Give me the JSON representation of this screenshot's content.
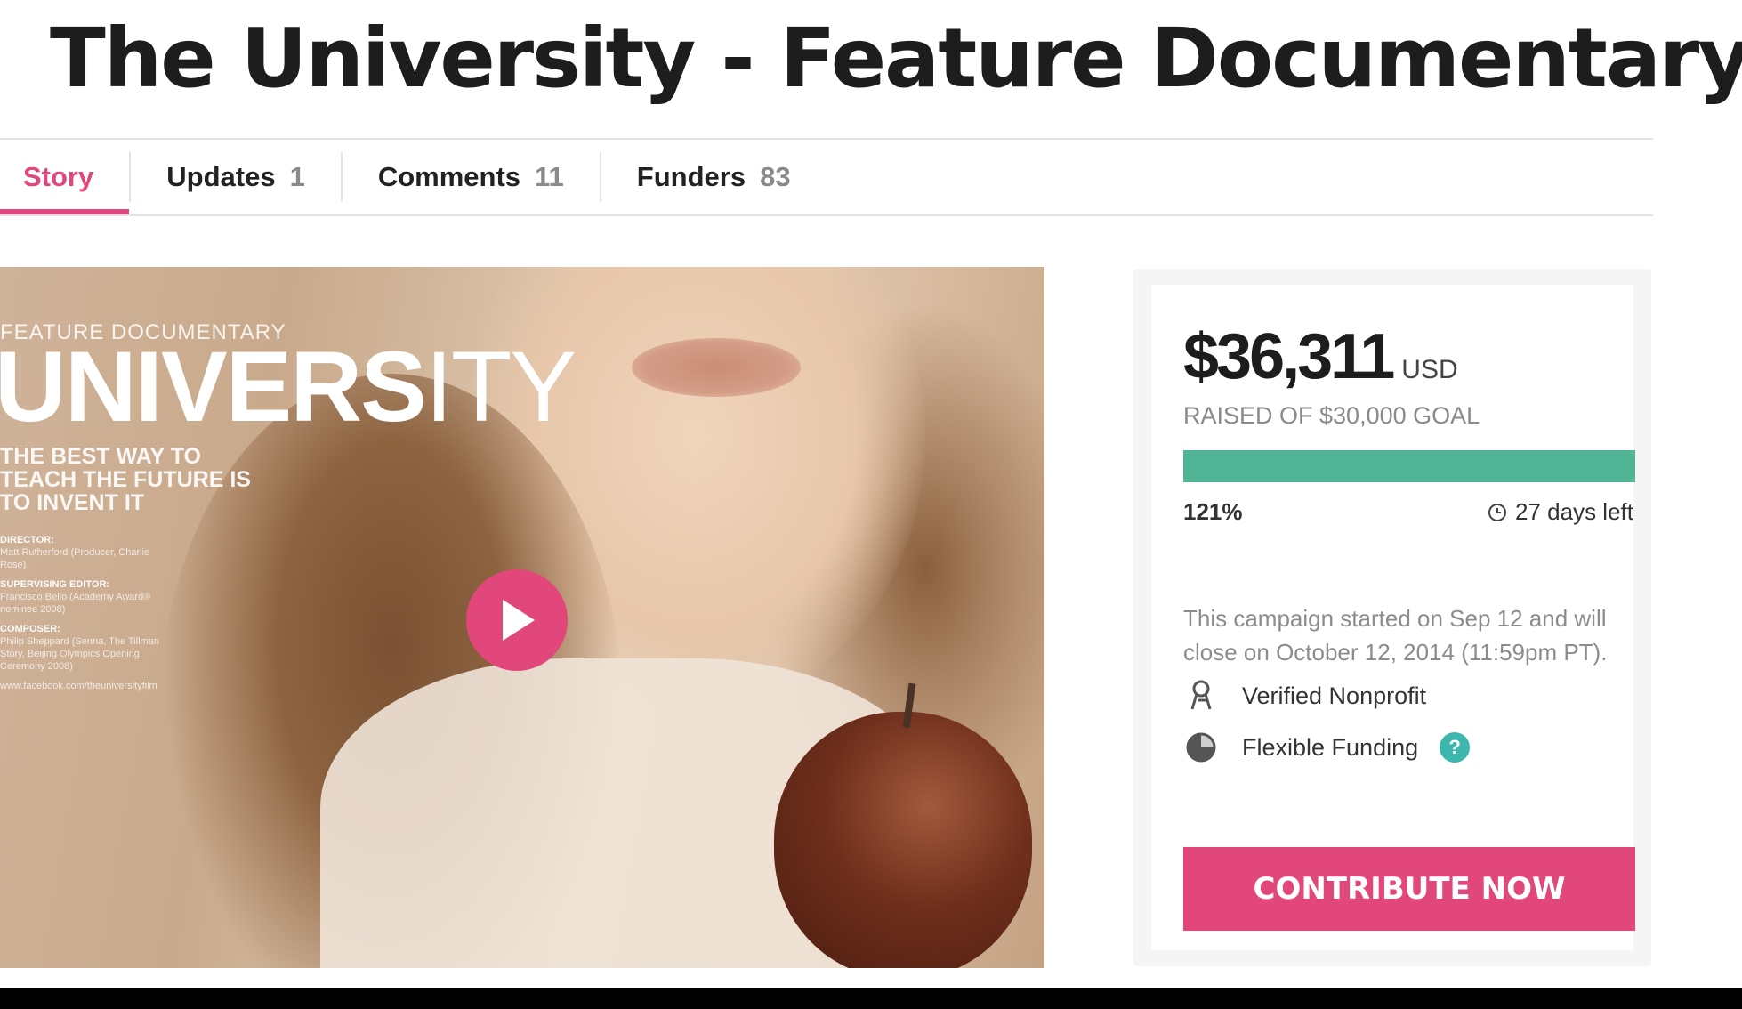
{
  "page": {
    "title": "The University - Feature Documentary"
  },
  "tabs": [
    {
      "label": "Story",
      "count": ""
    },
    {
      "label": "Updates",
      "count": "1"
    },
    {
      "label": "Comments",
      "count": "11"
    },
    {
      "label": "Funders",
      "count": "83"
    }
  ],
  "video": {
    "poster_kicker": "FEATURE DOCUMENTARY",
    "poster_logo_bold": "UNIVERS",
    "poster_logo_thin": "ITY",
    "poster_tagline": "THE BEST WAY TO TEACH THE FUTURE IS TO INVENT IT",
    "credits": [
      {
        "heading": "DIRECTOR:",
        "text": "Matt Rutherford (Producer, Charlie Rose)"
      },
      {
        "heading": "SUPERVISING EDITOR:",
        "text": "Francisco Bello (Academy Award® nominee 2008)"
      },
      {
        "heading": "COMPOSER:",
        "text": "Philip Sheppard (Senna, The Tillman Story, Beijing Olympics Opening Ceremony 2008)"
      },
      {
        "heading": "",
        "text": "www.facebook.com/theuniversityfilm"
      }
    ],
    "play_icon": "play-icon"
  },
  "campaign": {
    "amount": "$36,311",
    "currency": "USD",
    "goal_text": "RAISED OF $30,000 GOAL",
    "progress_fraction": 1.0,
    "percent_label": "121%",
    "days_left": "27 days left",
    "description": "This campaign started on Sep 12 and will close on October 12, 2014 (11:59pm PT).",
    "features": [
      {
        "label": "Verified Nonprofit",
        "icon": "ribbon-icon"
      },
      {
        "label": "Flexible Funding",
        "icon": "half-circle-icon"
      }
    ],
    "help_label": "?",
    "cta_label": "CONTRIBUTE NOW"
  },
  "colors": {
    "accent": "#e2477b",
    "progress": "#51b495",
    "help": "#3db7ad"
  }
}
